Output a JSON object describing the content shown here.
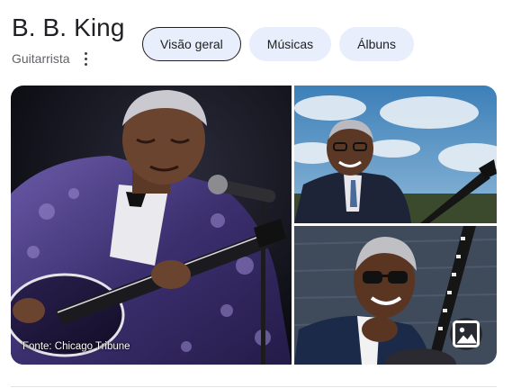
{
  "header": {
    "title": "B. B. King",
    "subtitle": "Guitarrista",
    "more_icon": "more-vert-icon"
  },
  "tabs": [
    {
      "label": "Visão geral",
      "active": true
    },
    {
      "label": "Músicas",
      "active": false
    },
    {
      "label": "Álbuns",
      "active": false
    }
  ],
  "gallery": {
    "source_caption": "Fonte: Chicago Tribune",
    "image_button_icon": "image-icon"
  },
  "colors": {
    "tab_background": "#e8eefb",
    "title_text": "#202124",
    "subtitle_text": "#5f6368"
  }
}
